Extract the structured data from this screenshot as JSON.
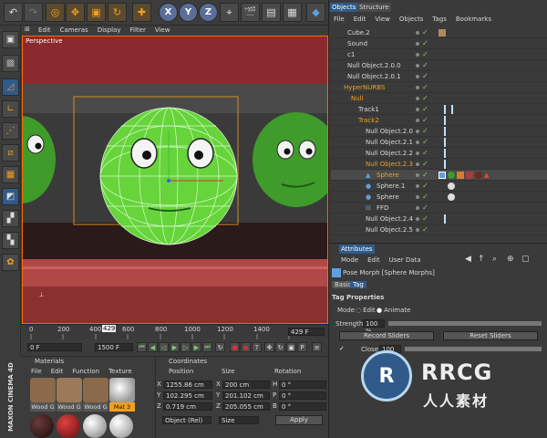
{
  "toolbar": {
    "x": "X",
    "y": "Y",
    "z": "Z"
  },
  "viewport": {
    "menu": [
      "Edit",
      "Cameras",
      "Display",
      "Filter",
      "View"
    ],
    "label": "Perspective"
  },
  "objects": {
    "tabs": [
      "Objects",
      "Structure"
    ],
    "menu": [
      "File",
      "Edit",
      "View",
      "Objects",
      "Tags",
      "Bookmarks"
    ],
    "rows": [
      {
        "name": "Cube.2",
        "color": "#d8d8d8"
      },
      {
        "name": "Sound",
        "color": "#d8d8d8"
      },
      {
        "name": "c1",
        "color": "#d8d8d8"
      },
      {
        "name": "Null Object.2.0.0",
        "color": "#d8d8d8"
      },
      {
        "name": "Null Object.2.0.1",
        "color": "#d8d8d8"
      },
      {
        "name": "HyperNURBS",
        "color": "#f0a020"
      },
      {
        "name": "Null",
        "color": "#f0a020"
      },
      {
        "name": "Track1",
        "color": "#d8d8d8"
      },
      {
        "name": "Track2",
        "color": "#f0a020"
      },
      {
        "name": "Null Object.2.0",
        "color": "#d8d8d8"
      },
      {
        "name": "Null Object.2.1",
        "color": "#d8d8d8"
      },
      {
        "name": "Null Object.2.2",
        "color": "#d8d8d8"
      },
      {
        "name": "Null Object.2.3",
        "color": "#f0a020"
      },
      {
        "name": "Sphere",
        "color": "#f0a020"
      },
      {
        "name": "Sphere.1",
        "color": "#d8d8d8"
      },
      {
        "name": "Sphere",
        "color": "#d8d8d8"
      },
      {
        "name": "FFD",
        "color": "#d8d8d8"
      },
      {
        "name": "Null Object.2.4",
        "color": "#d8d8d8"
      },
      {
        "name": "Null Object.2.5",
        "color": "#d8d8d8"
      }
    ]
  },
  "attributes": {
    "tab": "Attributes",
    "menu": [
      "Mode",
      "Edit",
      "User Data"
    ],
    "title": "Pose Morph [Sphere Morphs]",
    "subtabs": [
      "Basic",
      "Tag"
    ],
    "section": "Tag Properties",
    "mode_label": "Mode",
    "mode_edit": "Edit",
    "mode_animate": "Animate",
    "strength_label": "Strength",
    "strength_value": "100 %",
    "record_btn": "Record Sliders",
    "reset_btn": "Reset Sliders",
    "close_label": "Close",
    "close_value": "100 %"
  },
  "timeline": {
    "ticks": [
      "0",
      "200",
      "400",
      "600",
      "800",
      "1000",
      "1200",
      "1400"
    ],
    "current": "429",
    "end": "429 F",
    "start_frame": "0 F",
    "end_frame": "1500 F"
  },
  "materials": {
    "tab": "Materials",
    "menu": [
      "File",
      "Edit",
      "Function",
      "Texture"
    ],
    "items": [
      {
        "name": "Wood G",
        "color": "#8a6a4a"
      },
      {
        "name": "Wood G",
        "color": "#8a6a4a"
      },
      {
        "name": "Wood G",
        "color": "#8a6a4a"
      },
      {
        "name": "Mat 3",
        "color": "#d7d7d7"
      }
    ],
    "balls2": [
      "#3a1a1a",
      "#8a1a1a",
      "#b0b0b0",
      "#d0d0d0"
    ]
  },
  "coordinates": {
    "tab": "Coordinates",
    "headers": [
      "Position",
      "Size",
      "Rotation"
    ],
    "rows": [
      {
        "axis": "X",
        "pos": "1255.86 cm",
        "size": "200 cm",
        "rlabel": "H",
        "rot": "0 °"
      },
      {
        "axis": "Y",
        "pos": "102.295 cm",
        "size": "201.102 cm",
        "rlabel": "P",
        "rot": "0 °"
      },
      {
        "axis": "Z",
        "pos": "0.719 cm",
        "size": "205.055 cm",
        "rlabel": "B",
        "rot": "0 °"
      }
    ],
    "mode": "Object (Rel)",
    "size_mode": "Size",
    "apply": "Apply"
  },
  "brand": {
    "vertical": "MAXON CINEMA 4D",
    "watermark_title": "RRCG",
    "watermark_sub": "人人素材"
  }
}
